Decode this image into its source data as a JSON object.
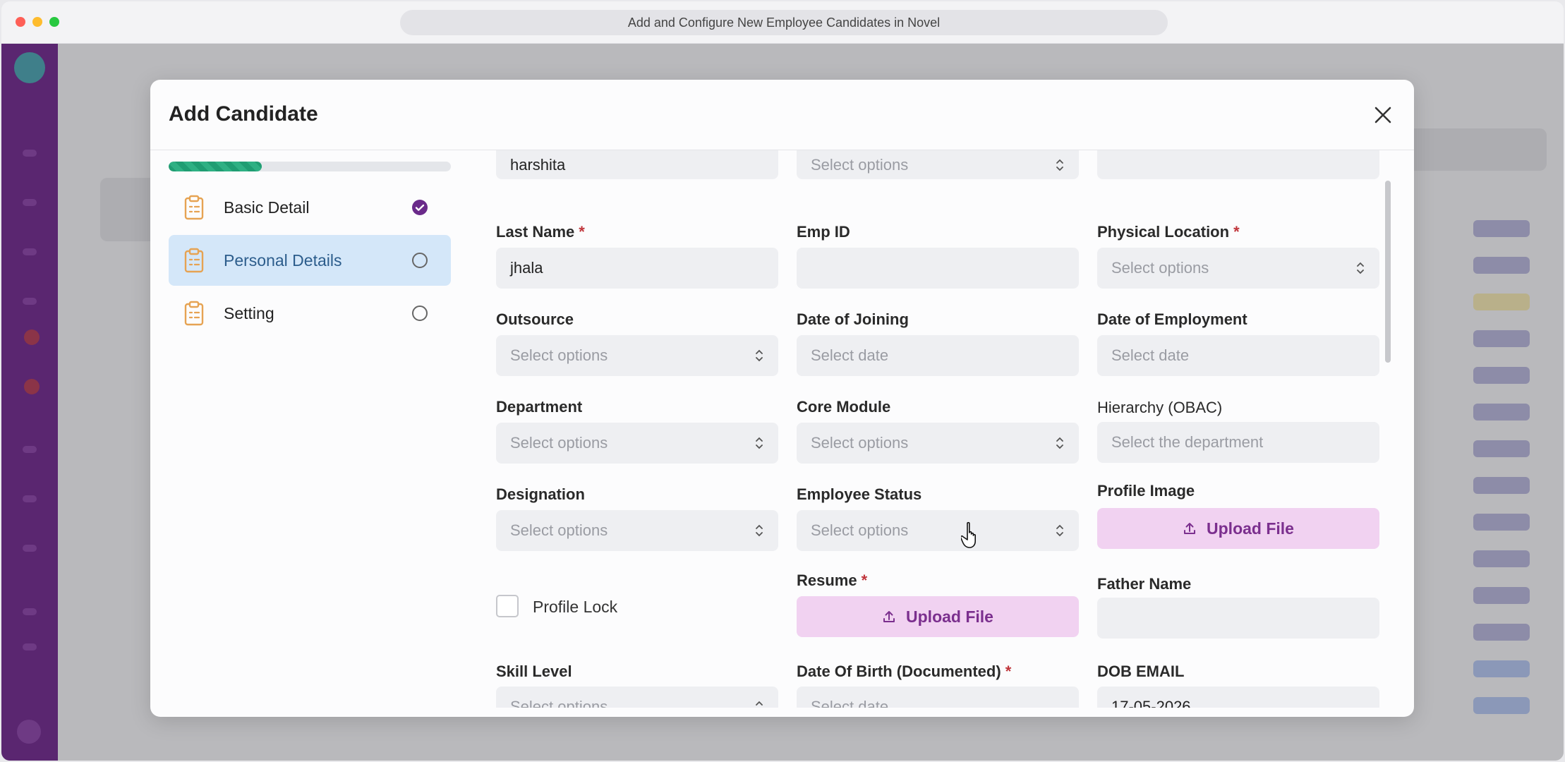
{
  "browser": {
    "title": "Add and Configure New Employee Candidates in Novel"
  },
  "modal": {
    "title": "Add Candidate",
    "progress_fraction": 0.33
  },
  "steps": [
    {
      "label": "Basic Detail",
      "status": "complete"
    },
    {
      "label": "Personal Details",
      "status": "active"
    },
    {
      "label": "Setting",
      "status": "pending"
    }
  ],
  "form": {
    "first_name": {
      "value": "harshita"
    },
    "top_middle": {
      "placeholder": "Select options"
    },
    "top_right": {
      "value": ""
    },
    "last_name": {
      "label": "Last Name",
      "value": "jhala"
    },
    "emp_id": {
      "label": "Emp ID",
      "value": ""
    },
    "physical_location": {
      "label": "Physical Location",
      "placeholder": "Select options"
    },
    "outsource": {
      "label": "Outsource",
      "placeholder": "Select options"
    },
    "date_of_joining": {
      "label": "Date of Joining",
      "placeholder": "Select date"
    },
    "date_of_employment": {
      "label": "Date of Employment",
      "placeholder": "Select date"
    },
    "department": {
      "label": "Department",
      "placeholder": "Select options"
    },
    "core_module": {
      "label": "Core Module",
      "placeholder": "Select options"
    },
    "hierarchy": {
      "label": "Hierarchy (OBAC)",
      "placeholder": "Select the department"
    },
    "designation": {
      "label": "Designation",
      "placeholder": "Select options"
    },
    "employee_status": {
      "label": "Employee Status",
      "placeholder": "Select options"
    },
    "profile_image": {
      "label": "Profile Image",
      "button": "Upload File"
    },
    "profile_lock": {
      "label": "Profile Lock",
      "checked": false
    },
    "resume": {
      "label": "Resume",
      "button": "Upload File"
    },
    "father_name": {
      "label": "Father Name",
      "value": ""
    },
    "skill_level": {
      "label": "Skill Level",
      "placeholder": "Select options"
    },
    "dob_documented": {
      "label": "Date Of Birth (Documented)",
      "placeholder": "Select date"
    },
    "dob_email": {
      "label": "DOB EMAIL",
      "value": "17-05-2026"
    },
    "required_mark": "*"
  },
  "colors": {
    "accent_purple": "#7b2f8e",
    "upload_bg": "#f1d2f1",
    "progress_green": "#1f9d72",
    "active_step_bg": "#d4e7f9",
    "check_purple": "#6a2a8a",
    "required_red": "#c0353b"
  },
  "icons": {
    "close": "close-icon",
    "step": "clipboard-icon",
    "step_complete": "check-circle-icon",
    "step_pending": "empty-circle-icon",
    "select": "chevron-updown-icon",
    "upload": "upload-icon"
  }
}
